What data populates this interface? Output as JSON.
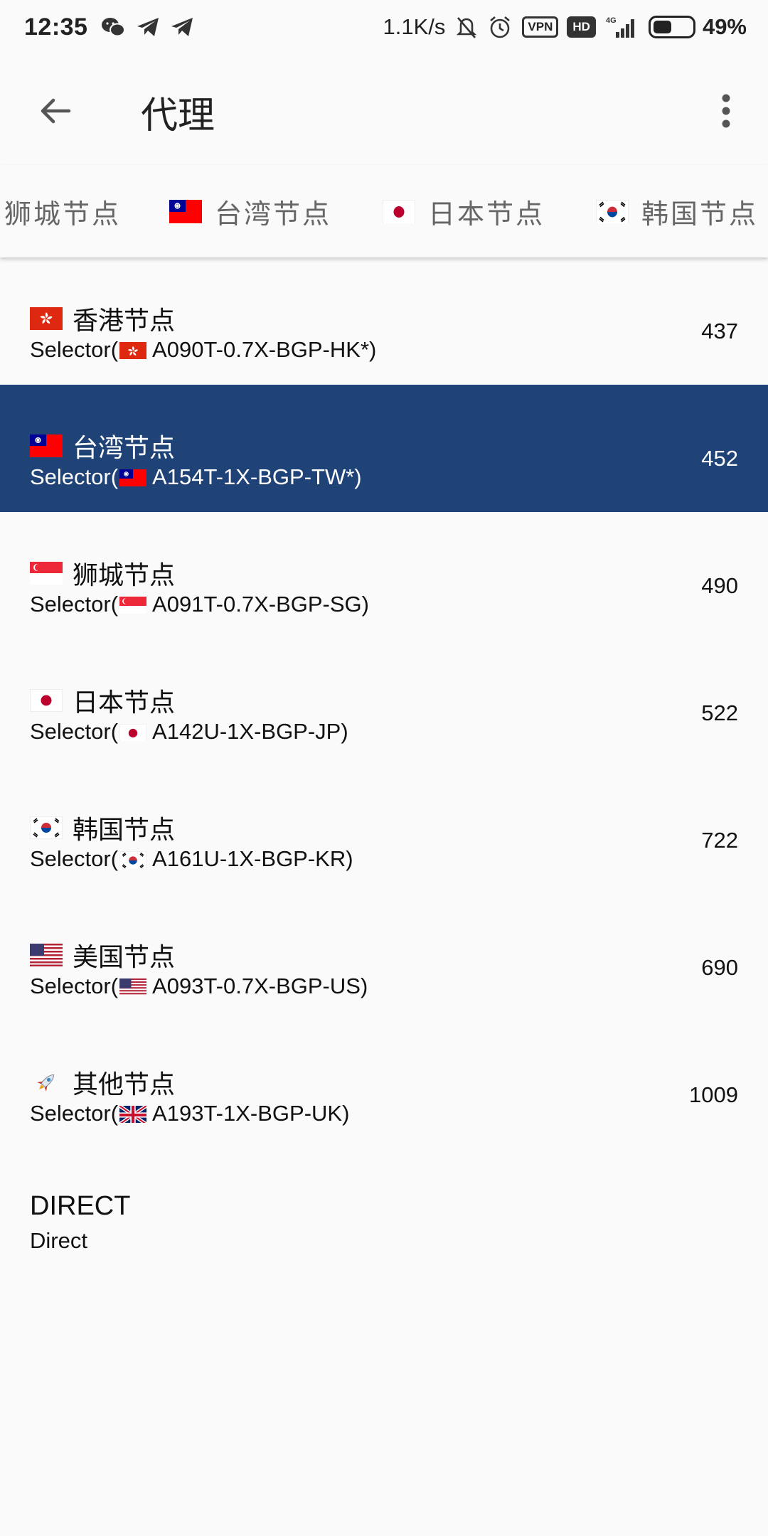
{
  "status_bar": {
    "time": "12:35",
    "net_speed": "1.1K/s",
    "vpn": "VPN",
    "hd": "HD",
    "signal": "4G",
    "battery": "49%",
    "battery_level": 0.49,
    "icons": [
      "wechat-icon",
      "telegram-icon",
      "telegram-icon",
      "mute-bell-icon",
      "alarm-icon",
      "signal-icon",
      "battery-icon"
    ]
  },
  "app_bar": {
    "title": "代理",
    "back_icon": "arrow-left-icon",
    "menu_icon": "more-vertical-icon"
  },
  "tabs": [
    {
      "label": "狮城节点",
      "flag": "sg"
    },
    {
      "label": "台湾节点",
      "flag": "tw"
    },
    {
      "label": "日本节点",
      "flag": "jp"
    },
    {
      "label": "韩国节点",
      "flag": "kr"
    }
  ],
  "groups": [
    {
      "name": "香港节点",
      "flag": "hk",
      "selector": "Selector(",
      "node": "A090T-0.7X-BGP-HK*)",
      "node_flag": "hk",
      "count": "437",
      "selected": false
    },
    {
      "name": "台湾节点",
      "flag": "tw",
      "selector": "Selector(",
      "node": "A154T-1X-BGP-TW*)",
      "node_flag": "tw",
      "count": "452",
      "selected": true
    },
    {
      "name": "狮城节点",
      "flag": "sg",
      "selector": "Selector(",
      "node": "A091T-0.7X-BGP-SG)",
      "node_flag": "sg",
      "count": "490",
      "selected": false
    },
    {
      "name": "日本节点",
      "flag": "jp",
      "selector": "Selector(",
      "node": "A142U-1X-BGP-JP)",
      "node_flag": "jp",
      "count": "522",
      "selected": false
    },
    {
      "name": "韩国节点",
      "flag": "kr",
      "selector": "Selector(",
      "node": "A161U-1X-BGP-KR)",
      "node_flag": "kr",
      "count": "722",
      "selected": false
    },
    {
      "name": "美国节点",
      "flag": "us",
      "selector": "Selector(",
      "node": "A093T-0.7X-BGP-US)",
      "node_flag": "us",
      "count": "690",
      "selected": false
    },
    {
      "name": "其他节点",
      "flag": "rocket",
      "selector": "Selector(",
      "node": "A193T-1X-BGP-UK)",
      "node_flag": "uk",
      "count": "1009",
      "selected": false
    }
  ],
  "direct": {
    "name": "DIRECT",
    "type": "Direct"
  },
  "colors": {
    "selected_bg": "#1f4377",
    "background": "#fafafa"
  }
}
